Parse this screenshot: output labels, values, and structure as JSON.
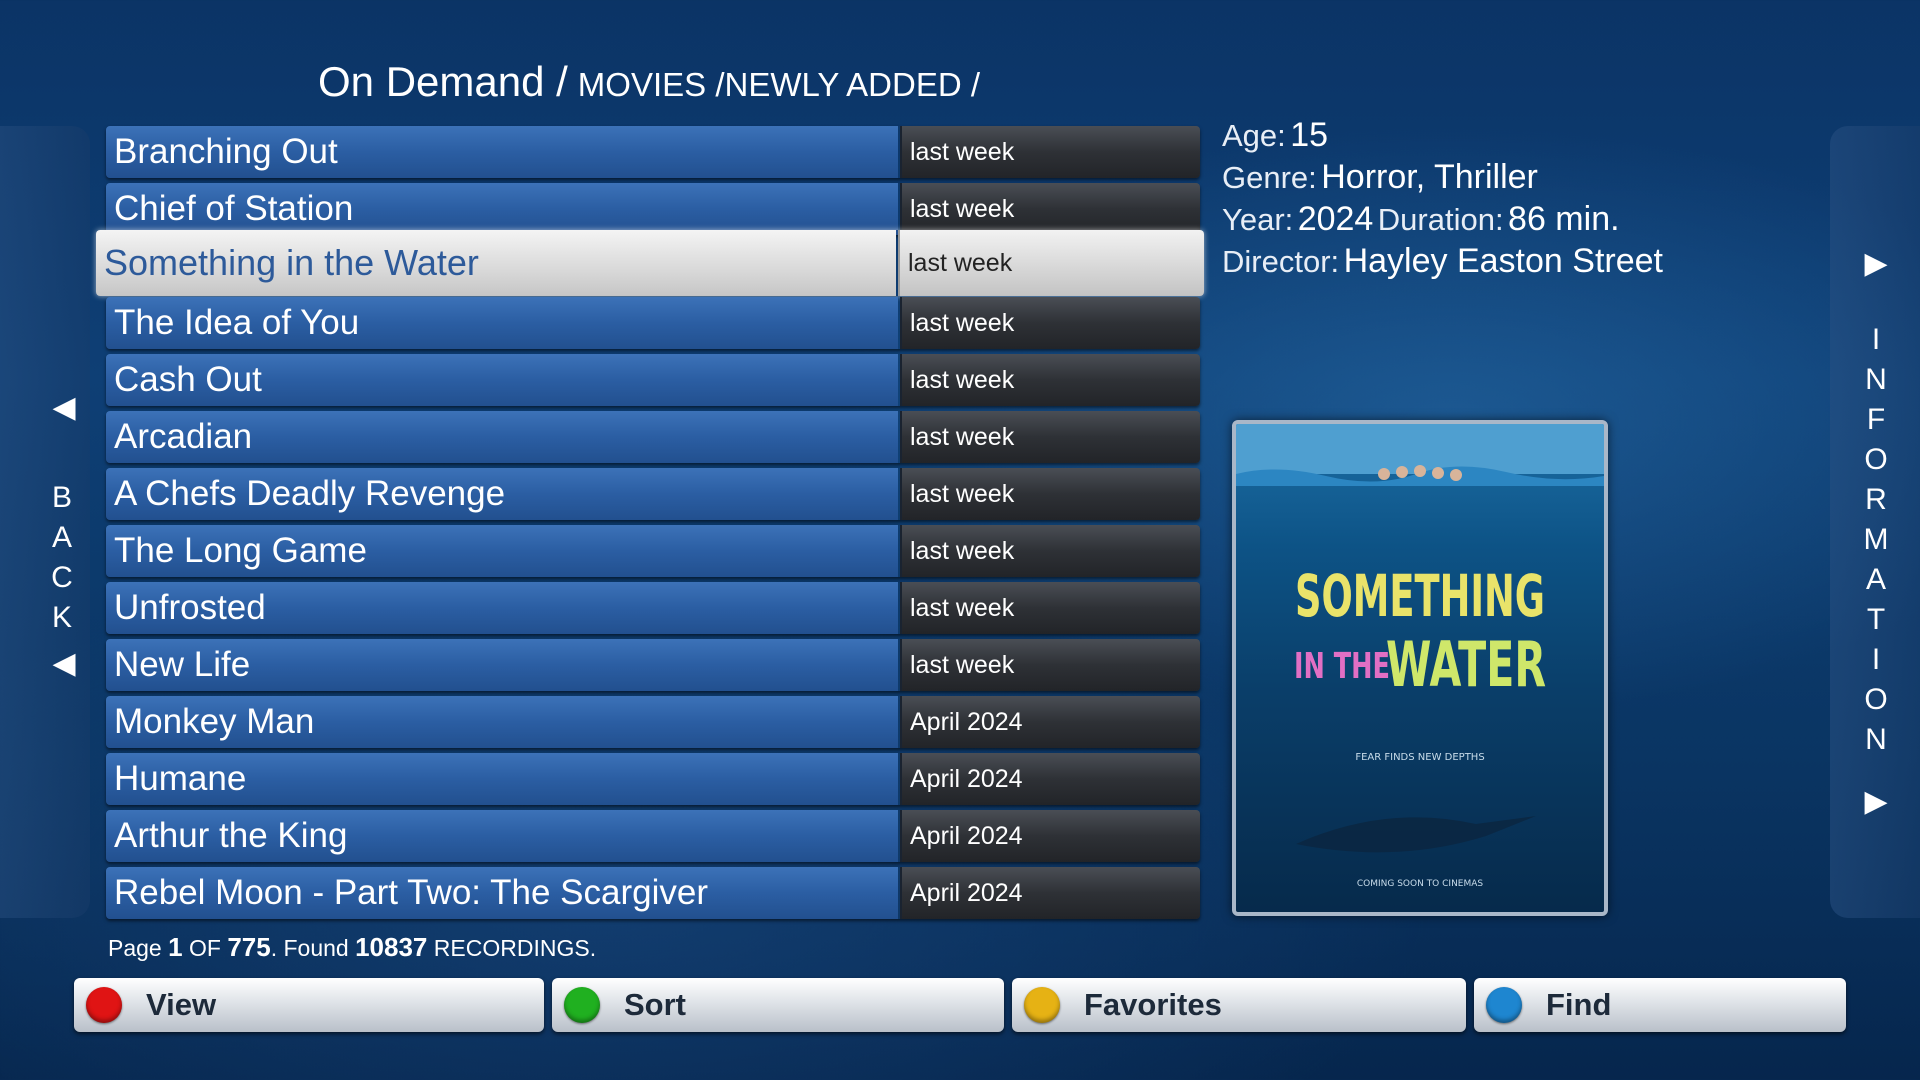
{
  "breadcrumb": {
    "root": "On Demand /",
    "path": "MOVIES /NEWLY ADDED /"
  },
  "back_panel": {
    "letters": [
      "B",
      "A",
      "C",
      "K"
    ],
    "arrow": "◀"
  },
  "info_panel": {
    "letters": [
      "I",
      "N",
      "F",
      "O",
      "R",
      "M",
      "A",
      "T",
      "I",
      "O",
      "N"
    ],
    "arrow": "▶"
  },
  "movies": [
    {
      "title": "Branching Out",
      "date": "last week"
    },
    {
      "title": "Chief of Station",
      "date": "last week"
    },
    {
      "title": "Something in the Water",
      "date": "last week",
      "selected": true
    },
    {
      "title": "The Idea of You",
      "date": "last week"
    },
    {
      "title": "Cash Out",
      "date": "last week"
    },
    {
      "title": "Arcadian",
      "date": "last week"
    },
    {
      "title": "A Chefs Deadly Revenge",
      "date": "last week"
    },
    {
      "title": "The Long Game",
      "date": "last week"
    },
    {
      "title": "Unfrosted",
      "date": "last week"
    },
    {
      "title": "New Life",
      "date": "last week"
    },
    {
      "title": "Monkey Man",
      "date": "April 2024"
    },
    {
      "title": "Humane",
      "date": "April 2024"
    },
    {
      "title": "Arthur the King",
      "date": "April 2024"
    },
    {
      "title": "Rebel Moon - Part Two: The Scargiver",
      "date": "April 2024"
    }
  ],
  "info": {
    "age_label": "Age:",
    "age": "15",
    "genre_label": "Genre:",
    "genre": "Horror, Thriller",
    "year_label": "Year:",
    "year": "2024",
    "duration_label": "Duration:",
    "duration": "86 min.",
    "director_label": "Director:",
    "director": "Hayley Easton Street"
  },
  "poster": {
    "line1": "SOMETHING",
    "line2a": "IN THE",
    "line2b": "WATER",
    "tagline": "FEAR FINDS NEW DEPTHS",
    "footer": "COMING SOON TO CINEMAS"
  },
  "status": {
    "page_prefix": "Page",
    "page": "1",
    "of_label": "OF",
    "total_pages": "775",
    "found_label": ". Found",
    "found": "10837",
    "recordings_label": "RECORDINGS."
  },
  "buttons": [
    {
      "label": "View",
      "color": "#e01414"
    },
    {
      "label": "Sort",
      "color": "#20b020"
    },
    {
      "label": "Favorites",
      "color": "#e6b214"
    },
    {
      "label": "Find",
      "color": "#1e86d0"
    }
  ],
  "colors": {
    "title_bar": "#2b5ea3",
    "date_bar": "#2e3136",
    "selected_text": "#2d5a9a",
    "background": "#0e3f75"
  }
}
